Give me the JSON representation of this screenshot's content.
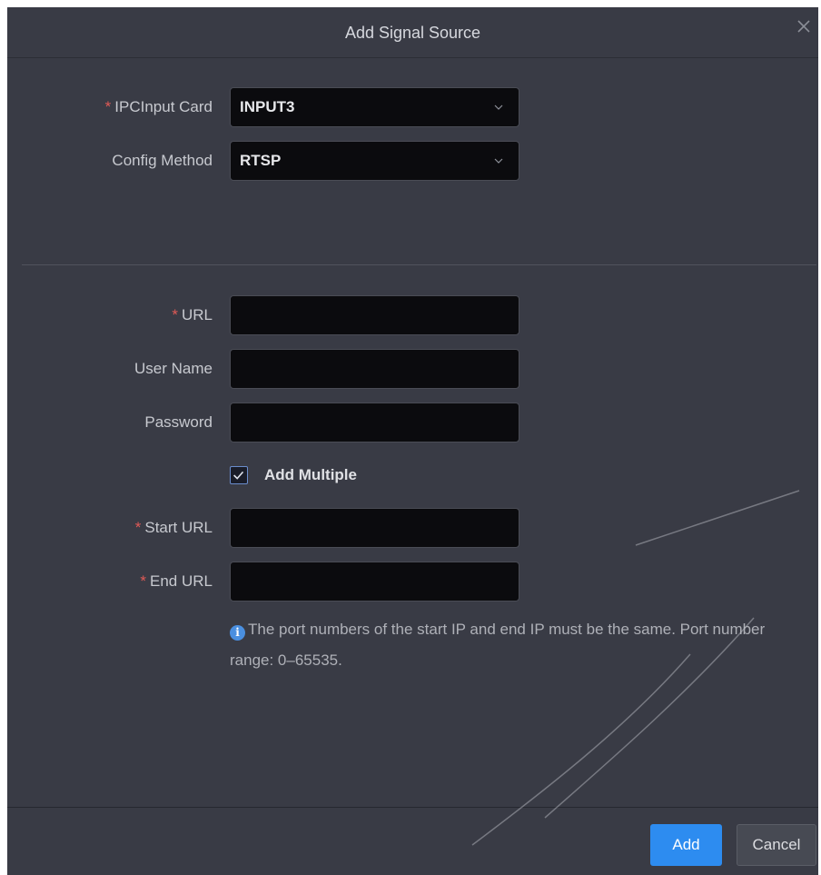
{
  "dialog": {
    "title": "Add Signal Source",
    "close_icon": "close-icon"
  },
  "form": {
    "required_mark": "*",
    "ipc_input_card": {
      "label": "IPCInput Card",
      "value": "INPUT3",
      "required": true
    },
    "config_method": {
      "label": "Config Method",
      "value": "RTSP",
      "required": false
    },
    "url": {
      "label": "URL",
      "value": "",
      "required": true
    },
    "user_name": {
      "label": "User Name",
      "value": ""
    },
    "password": {
      "label": "Password",
      "value": ""
    },
    "add_multiple": {
      "label": "Add Multiple",
      "checked": true
    },
    "start_url": {
      "label": "Start URL",
      "value": "",
      "required": true
    },
    "end_url": {
      "label": "End URL",
      "value": "",
      "required": true
    },
    "info_text": "The port numbers of the start IP and end IP must be the same. Port number range: 0–65535."
  },
  "footer": {
    "add_label": "Add",
    "cancel_label": "Cancel"
  },
  "colors": {
    "dialog_bg": "#393b45",
    "field_bg": "#0b0b0e",
    "primary": "#2d8cf0",
    "required": "#e05a56"
  }
}
